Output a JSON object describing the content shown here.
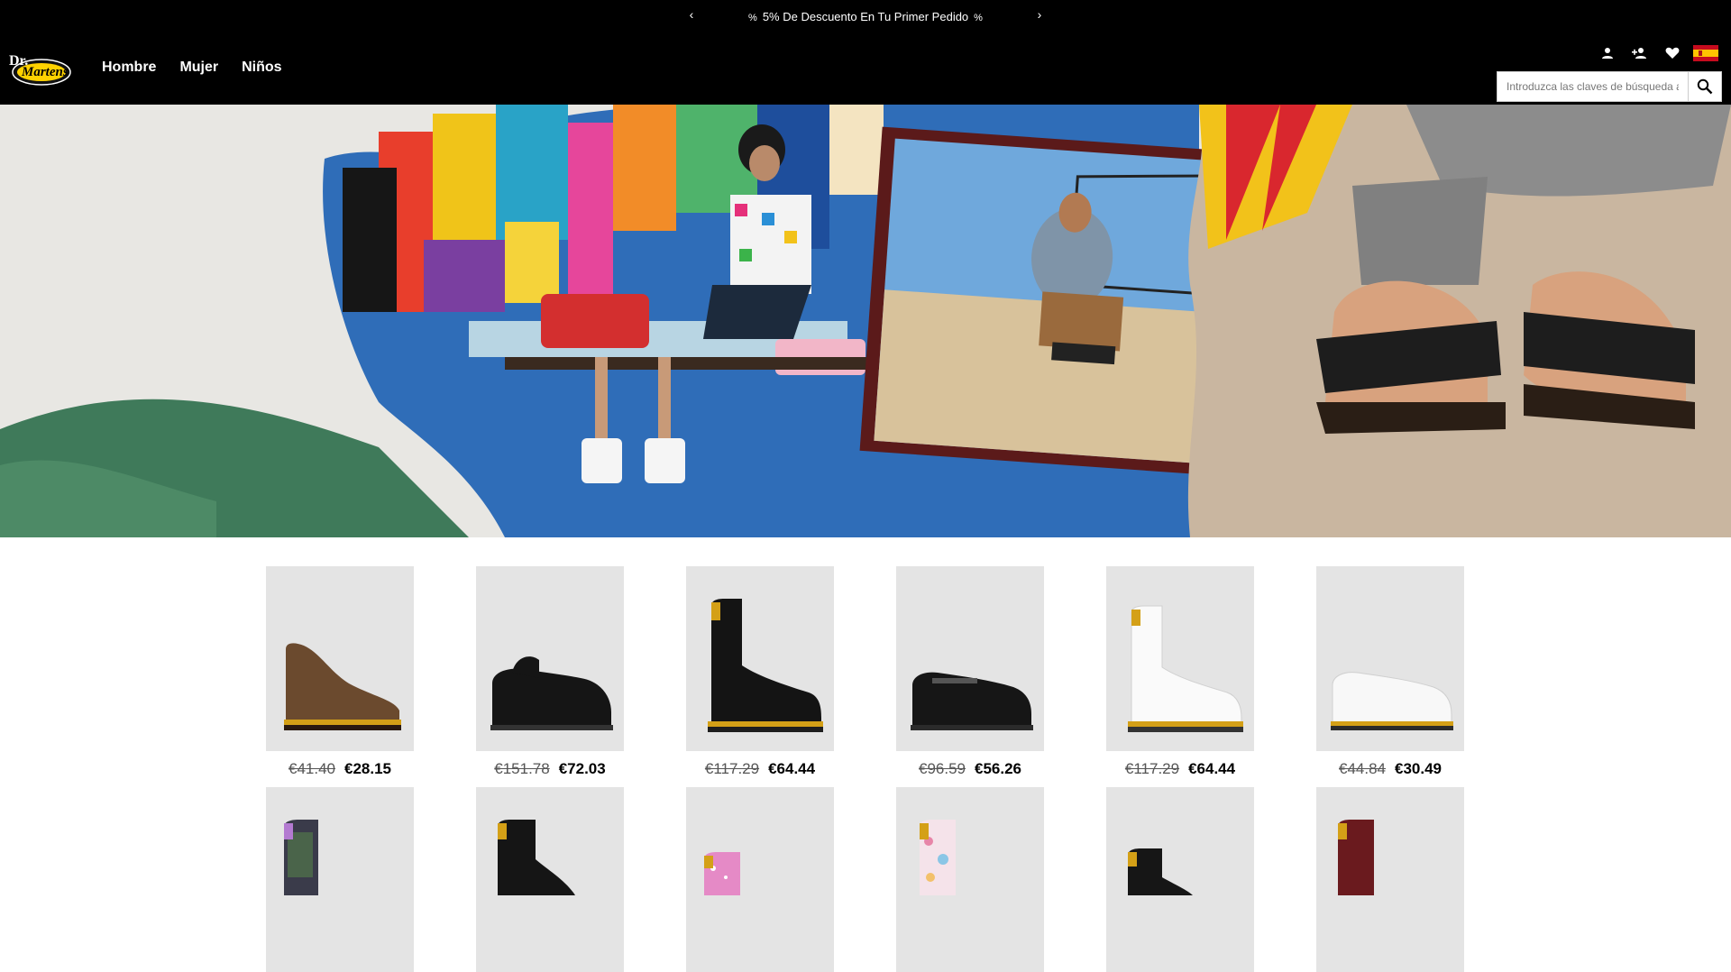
{
  "announcement": {
    "prev_arrow": "‹",
    "next_arrow": "›",
    "tag_left": "%",
    "text": "5% De Descuento En Tu Primer Pedido",
    "tag_right": "%"
  },
  "header": {
    "logo_alt": "Dr. Martens",
    "nav": [
      "Hombre",
      "Mujer",
      "Niños"
    ],
    "icons": [
      "user-icon",
      "add-user-icon",
      "heart-icon",
      "spain-flag-icon"
    ],
    "search": {
      "placeholder": "Introduzca las claves de búsqueda aquí"
    }
  },
  "hero": {
    "image": "summer-collection-banner"
  },
  "products_row1": [
    {
      "old": "€41.40",
      "new": "€28.15",
      "type": "chukka-brown"
    },
    {
      "old": "€151.78",
      "new": "€72.03",
      "type": "suede-mule-black"
    },
    {
      "old": "€117.29",
      "new": "€64.44",
      "type": "boot-black"
    },
    {
      "old": "€96.59",
      "new": "€56.26",
      "type": "strap-shoe-black"
    },
    {
      "old": "€117.29",
      "new": "€64.44",
      "type": "boot-white"
    },
    {
      "old": "€44.84",
      "new": "€30.49",
      "type": "oxford-white"
    }
  ],
  "products_row2": [
    {
      "type": "boot-iridescent"
    },
    {
      "type": "boot-black-zip"
    },
    {
      "type": "boot-pink-glitter"
    },
    {
      "type": "boot-floral"
    },
    {
      "type": "boot-black-kids"
    },
    {
      "type": "boot-cherry"
    }
  ],
  "colors": {
    "topbar": "#000000",
    "sole": "#d4a017",
    "accent": "#ffd200"
  }
}
